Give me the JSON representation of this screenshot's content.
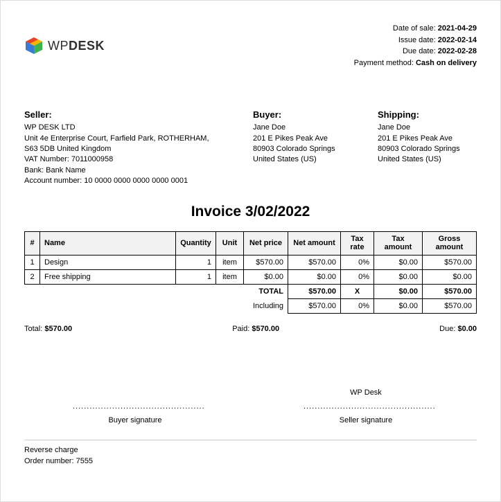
{
  "logo": {
    "brand_light": "WP",
    "brand_bold": "DESK"
  },
  "meta": {
    "date_of_sale_label": "Date of sale:",
    "date_of_sale": "2021-04-29",
    "issue_date_label": "Issue date:",
    "issue_date": "2022-02-14",
    "due_date_label": "Due date:",
    "due_date": "2022-02-28",
    "payment_method_label": "Payment method:",
    "payment_method": "Cash on delivery"
  },
  "seller": {
    "title": "Seller:",
    "name": "WP DESK LTD",
    "addr1": "Unit 4e Enterprise Court, Farfield Park, ROTHERHAM,",
    "addr2": "S63 5DB United Kingdom",
    "vat": "VAT Number: 7011000958",
    "bank": "Bank: Bank Name",
    "account": "Account number: 10 0000 0000 0000 0000 0001"
  },
  "buyer": {
    "title": "Buyer:",
    "name": "Jane Doe",
    "addr1": "201 E Pikes Peak Ave",
    "addr2": "80903 Colorado Springs",
    "addr3": "United States (US)"
  },
  "shipping": {
    "title": "Shipping:",
    "name": "Jane Doe",
    "addr1": "201 E Pikes Peak Ave",
    "addr2": "80903 Colorado Springs",
    "addr3": "United States (US)"
  },
  "invoice_title": "Invoice 3/02/2022",
  "columns": {
    "num": "#",
    "name": "Name",
    "qty": "Quantity",
    "unit": "Unit",
    "netprice": "Net price",
    "netamount": "Net amount",
    "taxrate": "Tax rate",
    "taxamount": "Tax amount",
    "gross": "Gross amount"
  },
  "rows": [
    {
      "num": "1",
      "name": "Design",
      "qty": "1",
      "unit": "item",
      "netprice": "$570.00",
      "netamount": "$570.00",
      "taxrate": "0%",
      "taxamount": "$0.00",
      "gross": "$570.00"
    },
    {
      "num": "2",
      "name": "Free shipping",
      "qty": "1",
      "unit": "item",
      "netprice": "$0.00",
      "netamount": "$0.00",
      "taxrate": "0%",
      "taxamount": "$0.00",
      "gross": "$0.00"
    }
  ],
  "summary": {
    "total_label": "TOTAL",
    "total": {
      "netamount": "$570.00",
      "taxrate": "X",
      "taxamount": "$0.00",
      "gross": "$570.00"
    },
    "including_label": "Including",
    "including": {
      "netamount": "$570.00",
      "taxrate": "0%",
      "taxamount": "$0.00",
      "gross": "$570.00"
    }
  },
  "totals_line": {
    "total_label": "Total:",
    "total_value": "$570.00",
    "paid_label": "Paid:",
    "paid_value": "$570.00",
    "due_label": "Due:",
    "due_value": "$0.00"
  },
  "signatures": {
    "seller_name": "WP Desk",
    "dots": "...............................................",
    "buyer_label": "Buyer signature",
    "seller_label": "Seller signature"
  },
  "footnotes": {
    "line1": "Reverse charge",
    "line2": "Order number: 7555"
  }
}
